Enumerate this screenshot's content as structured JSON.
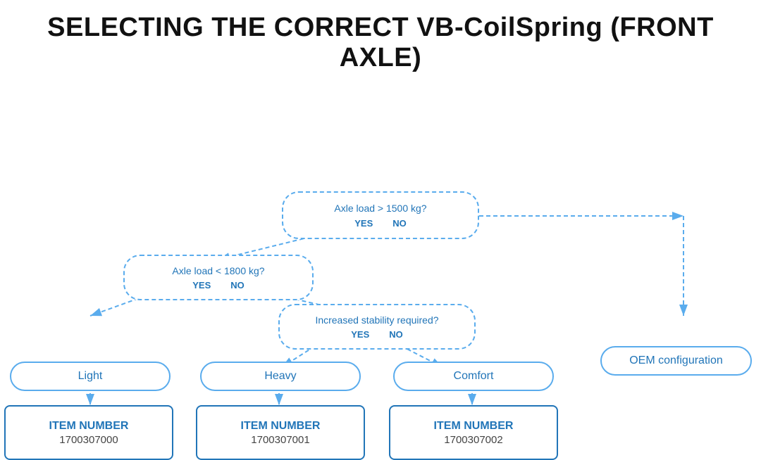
{
  "page": {
    "title": "SELECTING THE CORRECT VB-CoilSpring (FRONT AXLE)"
  },
  "diagram": {
    "decision1": {
      "question": "Axle load > 1500 kg?",
      "yes": "YES",
      "no": "NO"
    },
    "decision2": {
      "question": "Axle load < 1800 kg?",
      "yes": "YES",
      "no": "NO"
    },
    "decision3": {
      "question": "Increased stability required?",
      "yes": "YES",
      "no": "NO"
    },
    "outcomes": {
      "light": "Light",
      "heavy": "Heavy",
      "comfort": "Comfort",
      "oem": "OEM configuration"
    },
    "items": {
      "item0": {
        "label": "ITEM NUMBER",
        "number": "1700307000"
      },
      "item1": {
        "label": "ITEM NUMBER",
        "number": "1700307001"
      },
      "item2": {
        "label": "ITEM NUMBER",
        "number": "1700307002"
      }
    }
  }
}
